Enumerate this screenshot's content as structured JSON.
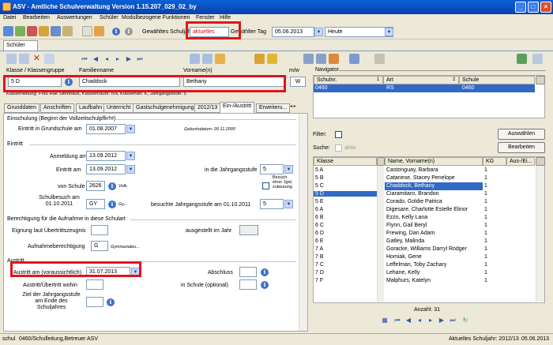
{
  "window": {
    "title": "ASV - Amtliche Schulverwaltung Version 1.15.207_029_02_by"
  },
  "menu": [
    "Datei",
    "Bearbeiten",
    "Auswertungen",
    "Schüler",
    "Modulbezogene Funktionen",
    "Fenster",
    "Hilfe"
  ],
  "toolbar": {
    "period_label": "Gewähltes Schuljahr",
    "period_value": "aktuelles",
    "day_label": "Gewählter Tag",
    "day_value": "05.06.2013",
    "view_value": "Heute"
  },
  "doc_tab": "Schüler",
  "header": {
    "class_label": "Klasse / Klassengruppe",
    "class_value": "5 D",
    "surname_label": "Familienname",
    "surname_value": "Chaddock",
    "firstname_label": "Vorname(n)",
    "firstname_value": "Bethany",
    "gender_label": "m/w",
    "gender_value": "W",
    "info_line": "Klassenleitung: Frau Rae Steinhaus, Klassenraum: n/a, Klassenart: K, Jahrgangsstufe: 5"
  },
  "tabs": [
    "Grunddaten",
    "Anschriften",
    "Laufbahn",
    "Unterricht",
    "Gastschulgenehmigung",
    "2012/13",
    "Ein-/Austritt",
    "Erweiteru..."
  ],
  "form": {
    "sec_einschulung": "Einschulung (Beginn der Vollzeitschulpflicht)",
    "einschulung_label": "Eintritt in Grundschule am",
    "einschulung_value": "01.08.2007",
    "geburtsdatum": "Geburtsdatum: 26.11.2000",
    "sec_eintritt": "Eintritt",
    "anmeldung_label": "Anmeldung am",
    "anmeldung_value": "13.09.2012",
    "eintritt_label": "Eintritt am",
    "eintritt_value": "13.09.2012",
    "jgst_label": "in die Jahrgangsstufe",
    "jgst_value": "5",
    "vonschule_label": "von Schule",
    "vonschule_value": "2626",
    "vonschule_suffix": "Volk.",
    "besuch_label": "Besuch einer Jgst. zulassung",
    "schulbesuch_label": "Schulbesuch am 01.10.2011",
    "schulbesuch_value": "GY",
    "schulbesuch_suffix": "Gy...",
    "besucht_label": "besuchte Jahrgangsstufe am 01.10.2011",
    "besucht_value": "5",
    "sec_berechtigung": "Berechtigung für die Aufnahme in diese Schulart",
    "eignung_label": "Eignung laut Übertrittszeugnis",
    "ausgestellt_label": "ausgestellt im Jahr",
    "aufnahme_label": "Aufnahmeberechtigung",
    "aufnahme_value": "G",
    "aufnahme_suffix": "Gymnasialeu...",
    "sec_austritt": "Austritt",
    "austritt_label": "Austritt am (voraussichtlich)",
    "austritt_value": "31.07.2013",
    "abschluss_label": "Abschluss",
    "uebertritt_label": "Austritt/Übertritt wohin",
    "inschule_label": "in Schule (optional)",
    "ziel_label": "Ziel der Jahrgangsstufe am Ende des Schuljahres"
  },
  "navigator": {
    "title": "Navigator",
    "cols": [
      "Schulnr.",
      "1",
      "Art",
      "2",
      "Schule"
    ],
    "row": [
      "0460",
      "RS",
      "0460"
    ],
    "filter_label": "Filter:",
    "search_label": "Suche:",
    "aktiv_label": "aktiv",
    "btn_select": "Auswählen",
    "btn_edit": "Bearbeiten",
    "list_cols": [
      "Klasse",
      "Name, Vorname(n)",
      "KG",
      "Aus-/Ei..."
    ],
    "rows": [
      {
        "k": "5 A",
        "n": "Castonguay, Barbara",
        "g": "1"
      },
      {
        "k": "5 B",
        "n": "Catanese, Stacey Penelope",
        "g": "1"
      },
      {
        "k": "5 C",
        "n": "Chaddock, Bethany",
        "g": "1"
      },
      {
        "k": "5 D",
        "n": "Ciaramitaro, Brandon",
        "g": "1"
      },
      {
        "k": "5 E",
        "n": "Corado, Goldie Patrica",
        "g": "1"
      },
      {
        "k": "6 A",
        "n": "Digesare, Charlotte Estelle Elinor",
        "g": "1"
      },
      {
        "k": "6 B",
        "n": "Ezzo, Kelly Lana",
        "g": "1"
      },
      {
        "k": "6 C",
        "n": "Flynn, Gail Beryl",
        "g": "1"
      },
      {
        "k": "6 D",
        "n": "Frewing, Dan Adam",
        "g": "1"
      },
      {
        "k": "6 E",
        "n": "Gatley, Malinda",
        "g": "1"
      },
      {
        "k": "7 A",
        "n": "Goracke, Williams Darryl Rodger",
        "g": "1"
      },
      {
        "k": "7 B",
        "n": "Homiak, Gene",
        "g": "1"
      },
      {
        "k": "7 C",
        "n": "Leffelman, Toby Zachary",
        "g": "1"
      },
      {
        "k": "7 D",
        "n": "Lehane, Kelly",
        "g": "1"
      },
      {
        "k": "7 F",
        "n": "Malphurs, Katelyn",
        "g": "1"
      }
    ],
    "count": "Anzahl: 31"
  },
  "status": {
    "left1": "schul",
    "left2": "0460/Schulleitung,Betreuer ASV",
    "right1": "Aktuelles Schuljahr: 2012/13",
    "right2": "05.06.2013"
  }
}
